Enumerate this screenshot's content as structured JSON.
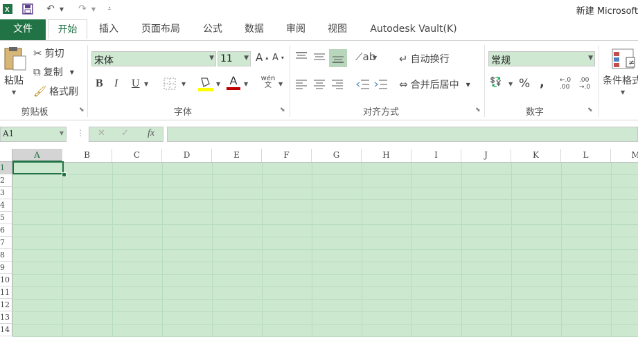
{
  "title_bar": {
    "title": "新建 Microsoft"
  },
  "tabs": [
    "文件",
    "开始",
    "插入",
    "页面布局",
    "公式",
    "数据",
    "审阅",
    "视图",
    "Autodesk Vault(K)"
  ],
  "clipboard": {
    "paste": "粘贴",
    "cut": "剪切",
    "copy": "复制",
    "format_painter": "格式刷",
    "group_label": "剪贴板"
  },
  "font": {
    "name": "宋体",
    "size": "11",
    "bold": "B",
    "italic": "I",
    "underline": "U",
    "font_color_glyph": "A",
    "phonetic_glyph": "wén文",
    "group_label": "字体"
  },
  "alignment": {
    "wrap_text": "自动换行",
    "merge_center": "合并后居中",
    "group_label": "对齐方式"
  },
  "number": {
    "format": "常规",
    "percent": "%",
    "comma": ",",
    "inc_decimal": "←.0 .00",
    "dec_decimal": ".00 →.0",
    "group_label": "数字"
  },
  "styles": {
    "conditional_formatting": "条件格式"
  },
  "formula_bar": {
    "name_box": "A1",
    "cancel": "✕",
    "enter": "✓",
    "fx": "fx"
  },
  "grid": {
    "columns": [
      "A",
      "B",
      "C",
      "D",
      "E",
      "F",
      "G",
      "H",
      "I",
      "J",
      "K",
      "L",
      "M"
    ],
    "rows": [
      "1",
      "2",
      "3",
      "4",
      "5",
      "6",
      "7",
      "8",
      "9",
      "10",
      "11",
      "12",
      "13",
      "14"
    ],
    "active_cell": "A1"
  },
  "colors": {
    "accent": "#217346",
    "cell_fill": "#cce8cf",
    "font_color_bar": "#c00000",
    "highlight_bar": "#ffff00"
  }
}
